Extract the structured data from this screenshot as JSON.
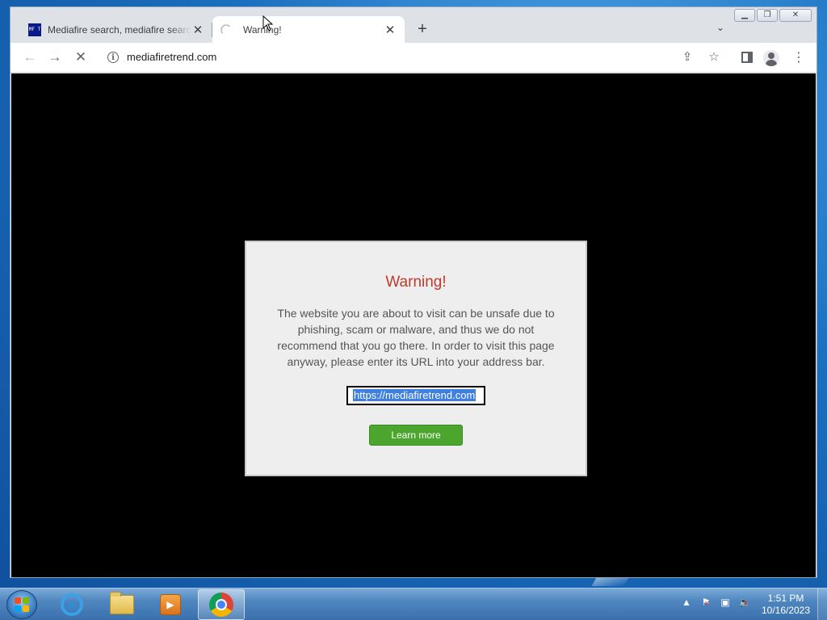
{
  "browser": {
    "tabs": [
      {
        "title": "Mediafire search, mediafire search",
        "favicon_text": "MF T",
        "active": false
      },
      {
        "title": "Warning!",
        "active": true
      }
    ],
    "new_tab_symbol": "+",
    "address_bar": {
      "url": "mediafiretrend.com"
    }
  },
  "page": {
    "dialog": {
      "title": "Warning!",
      "message": "The website you are about to visit can be unsafe due to phishing, scam or malware, and thus we do not recommend that you go there. In order to visit this page anyway, please enter its URL into your address bar.",
      "url_value": "https://mediafiretrend.com",
      "button_label": "Learn more"
    }
  },
  "taskbar": {
    "clock": {
      "time": "1:51 PM",
      "date": "10/16/2023"
    }
  },
  "colors": {
    "warning_title": "#c0392b",
    "button_green": "#4ca62e",
    "selection_blue": "#3f7fe0",
    "page_background": "#000000"
  },
  "icons": {
    "back": "arrow-left-icon",
    "forward": "arrow-right-icon",
    "reload": "stop-loading-icon",
    "site_info": "info-icon",
    "share": "share-icon",
    "bookmark": "star-icon",
    "side_panel": "side-panel-icon",
    "profile": "profile-icon",
    "menu": "kebab-menu-icon"
  }
}
